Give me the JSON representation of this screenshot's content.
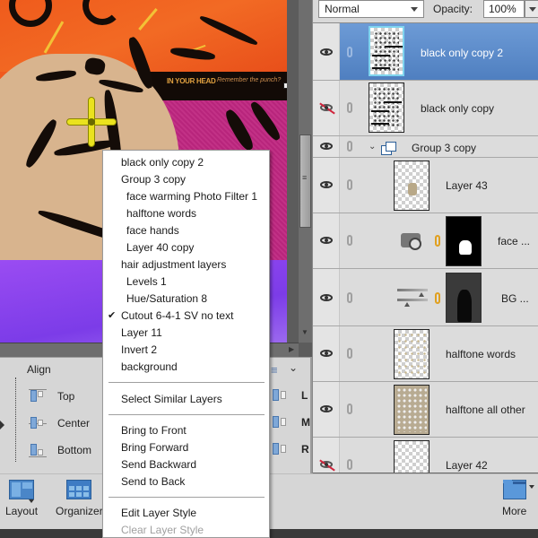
{
  "canvas": {
    "artwork_title_text": "IN YOUR HEAD",
    "artwork_subtitle_text": "Remember the punch?",
    "colors": {
      "orange": "#f05a1e",
      "magenta": "#b8257c",
      "purple": "#8a46ee",
      "skin": "#d8b48e",
      "crosshair": "#eae21e"
    }
  },
  "tool_options": {
    "align_label": "Align",
    "align_items": [
      {
        "label": "Top",
        "icon": "align-top-icon"
      },
      {
        "label": "Center",
        "icon": "align-center-icon"
      },
      {
        "label": "Bottom",
        "icon": "align-bottom-icon"
      }
    ],
    "distribute_items": [
      {
        "label": "L",
        "icon": "align-left-icon"
      },
      {
        "label": "M",
        "icon": "align-middle-icon"
      },
      {
        "label": "R",
        "icon": "align-right-icon"
      }
    ]
  },
  "taskbar": {
    "layout_label": "Layout",
    "organizer_label": "Organizer",
    "more_label": "More"
  },
  "layers_panel": {
    "blend_mode": "Normal",
    "opacity_label": "Opacity:",
    "opacity_value": "100%",
    "layers": [
      {
        "name": "black only copy 2",
        "visible": true,
        "selected": true
      },
      {
        "name": "black only copy",
        "visible": false,
        "selected": false
      },
      {
        "name": "Group 3 copy",
        "visible": true,
        "type": "group",
        "expanded": true
      },
      {
        "name": "Layer 43",
        "visible": true
      },
      {
        "name": "face ...",
        "visible": true,
        "type": "photo-filter-adjustment"
      },
      {
        "name": "BG ...",
        "visible": true,
        "type": "levels-adjustment"
      },
      {
        "name": "halftone words",
        "visible": true
      },
      {
        "name": "halftone all other",
        "visible": true
      },
      {
        "name": "Layer 42",
        "visible": false
      }
    ]
  },
  "context_menu": {
    "layer_items": [
      {
        "label": "black only copy 2",
        "indent": false
      },
      {
        "label": "Group 3 copy",
        "indent": false
      },
      {
        "label": "face warming Photo Filter 1",
        "indent": true
      },
      {
        "label": "halftone words",
        "indent": true
      },
      {
        "label": "face hands",
        "indent": true
      },
      {
        "label": "Layer 40 copy",
        "indent": true
      },
      {
        "label": "hair adjustment layers",
        "indent": false
      },
      {
        "label": "Levels 1",
        "indent": true
      },
      {
        "label": "Hue/Saturation 8",
        "indent": true
      },
      {
        "label": "Cutout 6-4-1  SV no text",
        "indent": false,
        "checked": true
      },
      {
        "label": "Layer 11",
        "indent": false
      },
      {
        "label": "Invert 2",
        "indent": false
      },
      {
        "label": "background",
        "indent": false
      }
    ],
    "select_similar": "Select Similar Layers",
    "arrange_items": [
      "Bring to Front",
      "Bring Forward",
      "Send Backward",
      "Send to Back"
    ],
    "style_items": [
      {
        "label": "Edit Layer Style",
        "disabled": false
      },
      {
        "label": "Clear Layer Style",
        "disabled": true
      }
    ],
    "check_glyph": "✔"
  }
}
